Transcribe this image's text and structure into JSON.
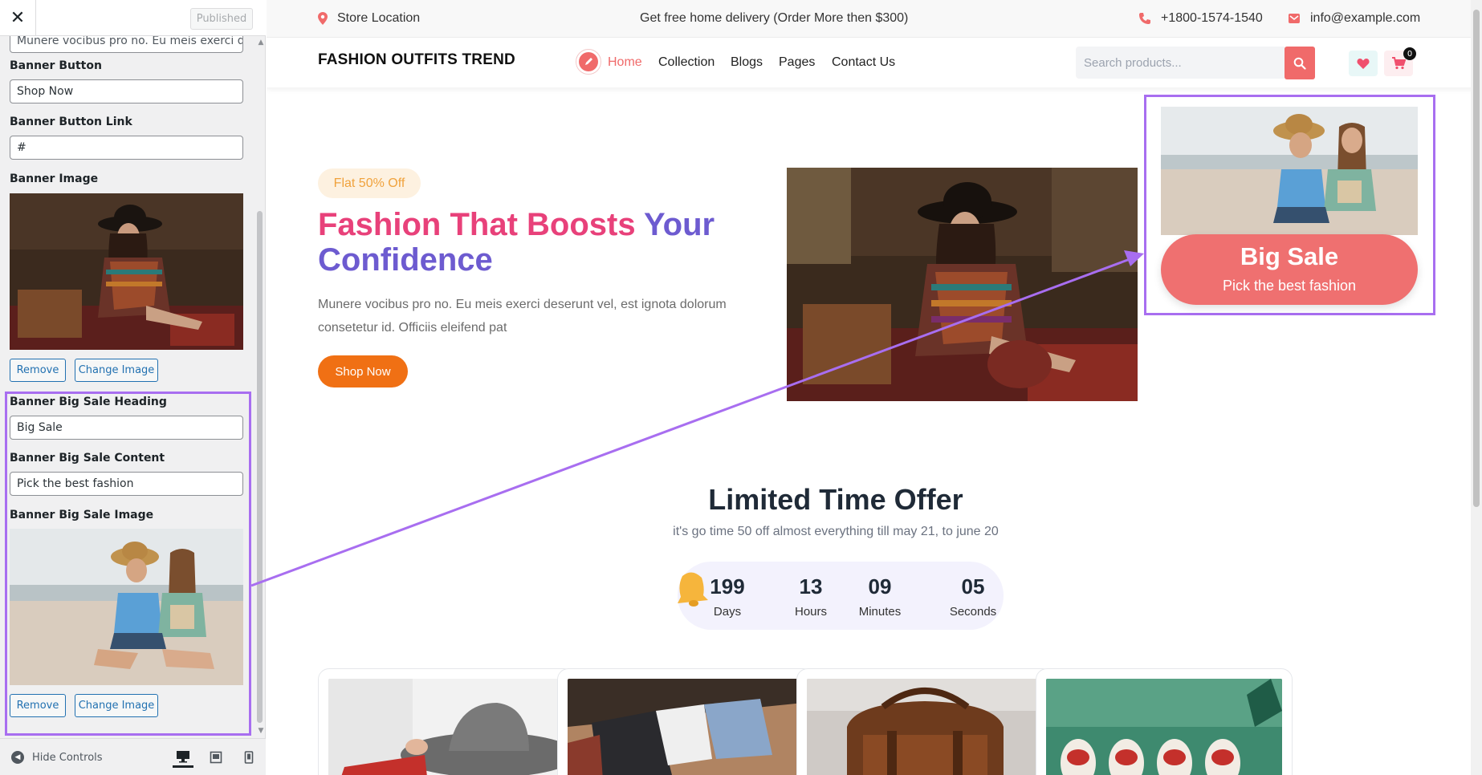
{
  "customizer": {
    "close_label": "✕",
    "published_label": "Published",
    "partial_content_value": "Munere vocibus pro no. Eu meis exerci deserunt",
    "banner_button": {
      "label": "Banner Button",
      "value": "Shop Now"
    },
    "banner_button_link": {
      "label": "Banner Button Link",
      "value": "#"
    },
    "banner_image": {
      "label": "Banner Image",
      "remove": "Remove",
      "change": "Change Image"
    },
    "big_sale_heading": {
      "label": "Banner Big Sale Heading",
      "value": "Big Sale"
    },
    "big_sale_content": {
      "label": "Banner Big Sale Content",
      "value": "Pick the best fashion"
    },
    "big_sale_image": {
      "label": "Banner Big Sale Image",
      "remove": "Remove",
      "change": "Change Image"
    },
    "hide_controls": "Hide Controls",
    "devices": [
      "desktop",
      "tablet",
      "mobile"
    ]
  },
  "topbar": {
    "location": "Store Location",
    "promo": "Get free home delivery (Order More then $300)",
    "phone": "+1800-1574-1540",
    "email": "info@example.com"
  },
  "navbar": {
    "brand": "FASHION OUTFITS TREND",
    "links": [
      "Home",
      "Collection",
      "Blogs",
      "Pages",
      "Contact Us"
    ],
    "active_link": "Home",
    "search_placeholder": "Search products...",
    "cart_count": "0"
  },
  "hero": {
    "badge": "Flat 50% Off",
    "title_part1": "Fashion That Boosts",
    "title_part2": "Your",
    "title_part3": "Confidence",
    "text": "Munere vocibus pro no. Eu meis exerci deserunt vel, est ignota dolorum consetetur id. Officiis eleifend pat",
    "button": "Shop Now"
  },
  "big_sale": {
    "heading": "Big Sale",
    "content": "Pick the best fashion"
  },
  "offer": {
    "title": "Limited Time Offer",
    "subtitle": "it's go time 50 off almost everything till may 21, to june 20",
    "countdown": [
      {
        "value": "199",
        "label": "Days"
      },
      {
        "value": "13",
        "label": "Hours"
      },
      {
        "value": "09",
        "label": "Minutes"
      },
      {
        "value": "05",
        "label": "Seconds"
      }
    ]
  },
  "colors": {
    "accent_red": "#f06a6a",
    "hero_pink": "#e8417a",
    "hero_purple": "#6d5bd0",
    "shop_orange": "#f07014",
    "highlight_purple": "#a86ef0",
    "wp_blue": "#2271b1"
  },
  "icons": {
    "topbar": [
      "map-pin-icon",
      "phone-icon",
      "mail-icon"
    ],
    "navbar": [
      "pencil-icon",
      "search-icon",
      "heart-icon",
      "cart-icon"
    ],
    "offer": "bell-icon"
  }
}
